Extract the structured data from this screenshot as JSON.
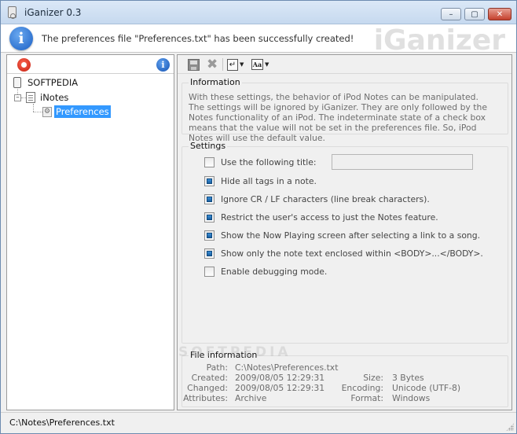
{
  "window": {
    "title": "iGanizer 0.3",
    "controls": {
      "minimize": "–",
      "maximize": "▢",
      "close": "✕"
    }
  },
  "banner": {
    "icon": "info-icon",
    "message": "The preferences file \"Preferences.txt\" has been successfully created!",
    "brand": "iGanizer"
  },
  "tree": {
    "header_icons": [
      "ipod-icon",
      "info-icon"
    ],
    "root": "SOFTPEDIA",
    "child": "iNotes",
    "grandchild": "Preferences",
    "expander_symbol": "–"
  },
  "toolbar": {
    "icons": [
      "save-icon",
      "delete-icon",
      "return-icon",
      "font-icon"
    ],
    "return_glyph": "↵",
    "font_glyph": "Aa",
    "caret": "▼"
  },
  "information": {
    "title": "Information",
    "text": "With these settings, the behavior of iPod Notes can be manipulated. The settings will be ignored by iGanizer. They are only followed by the Notes functionality of an iPod. The indeterminate state of a check box means that the value will not be set in the preferences file. So, iPod Notes will use the default value."
  },
  "settings": {
    "title": "Settings",
    "items": [
      {
        "label": "Use the following title:",
        "state": "unchecked",
        "has_input": true,
        "input_value": ""
      },
      {
        "label": "Hide all tags in a note.",
        "state": "indeterminate"
      },
      {
        "label": "Ignore CR / LF characters (line break characters).",
        "state": "indeterminate"
      },
      {
        "label": "Restrict the user's access to just the Notes feature.",
        "state": "indeterminate"
      },
      {
        "label": "Show the Now Playing screen after selecting a link to a song.",
        "state": "indeterminate"
      },
      {
        "label": "Show only the note text enclosed within <BODY>...</BODY>.",
        "state": "indeterminate"
      },
      {
        "label": "Enable debugging mode.",
        "state": "unchecked"
      }
    ]
  },
  "file_info": {
    "title": "File information",
    "path_label": "Path:",
    "path": "C:\\Notes\\Preferences.txt",
    "created_label": "Created:",
    "created": "2009/08/05 12:29:31",
    "changed_label": "Changed:",
    "changed": "2009/08/05 12:29:31",
    "attributes_label": "Attributes:",
    "attributes": "Archive",
    "size_label": "Size:",
    "size": "3 Bytes",
    "encoding_label": "Encoding:",
    "encoding": "Unicode (UTF-8)",
    "format_label": "Format:",
    "format": "Windows"
  },
  "watermark": "SOFTPEDIA",
  "status": {
    "path": "C:\\Notes\\Preferences.txt"
  },
  "colors": {
    "accent": "#3399ff",
    "checkbox_fill": "#1c5f9e",
    "banner_icon": "#1a5fc4"
  }
}
